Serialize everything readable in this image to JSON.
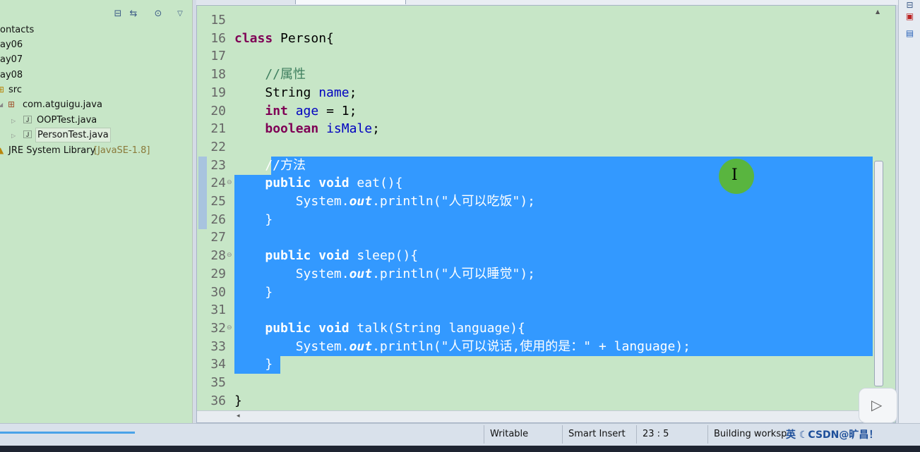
{
  "package_explorer": {
    "items": [
      {
        "label": "ontacts"
      },
      {
        "label": "ay06"
      },
      {
        "label": "ay07"
      },
      {
        "label": "ay08"
      },
      {
        "label": "src"
      },
      {
        "label": "com.atguigu.java"
      },
      {
        "label": "OOPTest.java"
      },
      {
        "label": "PersonTest.java"
      },
      {
        "label": "JRE System Library",
        "suffix": "[JavaSE-1.8]"
      }
    ]
  },
  "editor": {
    "lines": [
      {
        "n": "15"
      },
      {
        "n": "16"
      },
      {
        "n": "17"
      },
      {
        "n": "18"
      },
      {
        "n": "19"
      },
      {
        "n": "20"
      },
      {
        "n": "21"
      },
      {
        "n": "22"
      },
      {
        "n": "23"
      },
      {
        "n": "24"
      },
      {
        "n": "25"
      },
      {
        "n": "26"
      },
      {
        "n": "27"
      },
      {
        "n": "28"
      },
      {
        "n": "29"
      },
      {
        "n": "30"
      },
      {
        "n": "31"
      },
      {
        "n": "32"
      },
      {
        "n": "33"
      },
      {
        "n": "34"
      },
      {
        "n": "35"
      },
      {
        "n": "36"
      }
    ],
    "code": {
      "l16a": "class",
      "l16b": " Person{",
      "l18": "    //属性",
      "l19a": "    String ",
      "l19b": "name",
      "l19c": ";",
      "l20a": "    ",
      "l20b": "int",
      "l20c": " ",
      "l20d": "age",
      "l20e": " = 1;",
      "l21a": "    ",
      "l21b": "boolean",
      "l21c": " ",
      "l21d": "isMale",
      "l21e": ";",
      "l23": "    //方法",
      "l24a": "    ",
      "l24b": "public",
      "l24c": " ",
      "l24d": "void",
      "l24e": " eat(){",
      "l25a": "        System.",
      "l25b": "out",
      "l25c": ".println(",
      "l25d": "\"人可以吃饭\"",
      "l25e": ");",
      "l26": "    }",
      "l28a": "    ",
      "l28b": "public",
      "l28c": " ",
      "l28d": "void",
      "l28e": " sleep(){",
      "l29a": "        System.",
      "l29b": "out",
      "l29c": ".println(",
      "l29d": "\"人可以睡觉\"",
      "l29e": ");",
      "l30": "    }",
      "l32a": "    ",
      "l32b": "public",
      "l32c": " ",
      "l32d": "void",
      "l32e": " talk(String language){",
      "l33a": "        System.",
      "l33b": "out",
      "l33c": ".println(",
      "l33d": "\"人可以说话,使用的是：\"",
      "l33e": " + language);",
      "l34": "    }",
      "l36": "}"
    }
  },
  "statusbar": {
    "writable": "Writable",
    "insert_mode": "Smart Insert",
    "position": "23 : 5",
    "building": "Building worksp"
  },
  "ime": {
    "label": "英 ☾CSDN@旷昌！"
  },
  "icons": {
    "toolbar": [
      "collapse-all-icon",
      "link-editor-icon",
      "focus-icon",
      "view-menu-icon"
    ],
    "right": [
      "outline-icon",
      "task-list-icon",
      "console-icon"
    ],
    "video": "play-icon"
  },
  "colors": {
    "editor_bg": "#c7e6c7",
    "selection": "#3399ff",
    "keyword": "#7f0055",
    "field": "#0000c0",
    "comment": "#3f7f5f",
    "string": "#2a00ff"
  }
}
